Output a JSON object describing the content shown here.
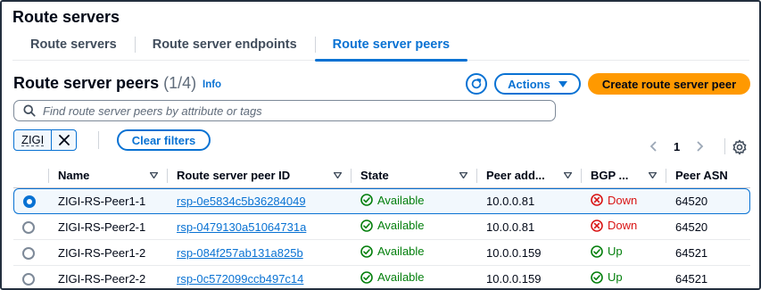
{
  "page": {
    "title": "Route servers"
  },
  "tabs": [
    {
      "label": "Route servers",
      "active": false
    },
    {
      "label": "Route server endpoints",
      "active": false
    },
    {
      "label": "Route server peers",
      "active": true
    }
  ],
  "header": {
    "title": "Route server peers",
    "count": "(1/4)",
    "info": "Info",
    "actions_label": "Actions",
    "create_label": "Create route server peer"
  },
  "search": {
    "placeholder": "Find route server peers by attribute or tags"
  },
  "filter": {
    "token": "ZIGI",
    "clear_label": "Clear filters"
  },
  "pagination": {
    "current": "1"
  },
  "table": {
    "columns": [
      "Name",
      "Route server peer ID",
      "State",
      "Peer add...",
      "BGP ...",
      "Peer ASN"
    ],
    "rows": [
      {
        "selected": true,
        "name": "ZIGI-RS-Peer1-1",
        "id": "rsp-0e5834c5b36284049",
        "state": "Available",
        "address": "10.0.0.81",
        "bgp": "Down",
        "asn": "64520"
      },
      {
        "selected": false,
        "name": "ZIGI-RS-Peer2-1",
        "id": "rsp-0479130a51064731a",
        "state": "Available",
        "address": "10.0.0.81",
        "bgp": "Down",
        "asn": "64520"
      },
      {
        "selected": false,
        "name": "ZIGI-RS-Peer1-2",
        "id": "rsp-084f257ab131a825b",
        "state": "Available",
        "address": "10.0.0.159",
        "bgp": "Up",
        "asn": "64521"
      },
      {
        "selected": false,
        "name": "ZIGI-RS-Peer2-2",
        "id": "rsp-0c572099ccb497c14",
        "state": "Available",
        "address": "10.0.0.159",
        "bgp": "Up",
        "asn": "64521"
      }
    ]
  },
  "colors": {
    "accent": "#0972d3",
    "primary_button": "#ff9900",
    "success": "#037f0c",
    "error": "#d91515"
  },
  "icons": {
    "search": "search-icon",
    "refresh": "refresh-icon",
    "caret": "caret-down-icon",
    "remove": "close-icon",
    "settings": "gear-icon",
    "available": "check-circle-icon",
    "down": "x-circle-icon",
    "up": "check-circle-icon"
  }
}
